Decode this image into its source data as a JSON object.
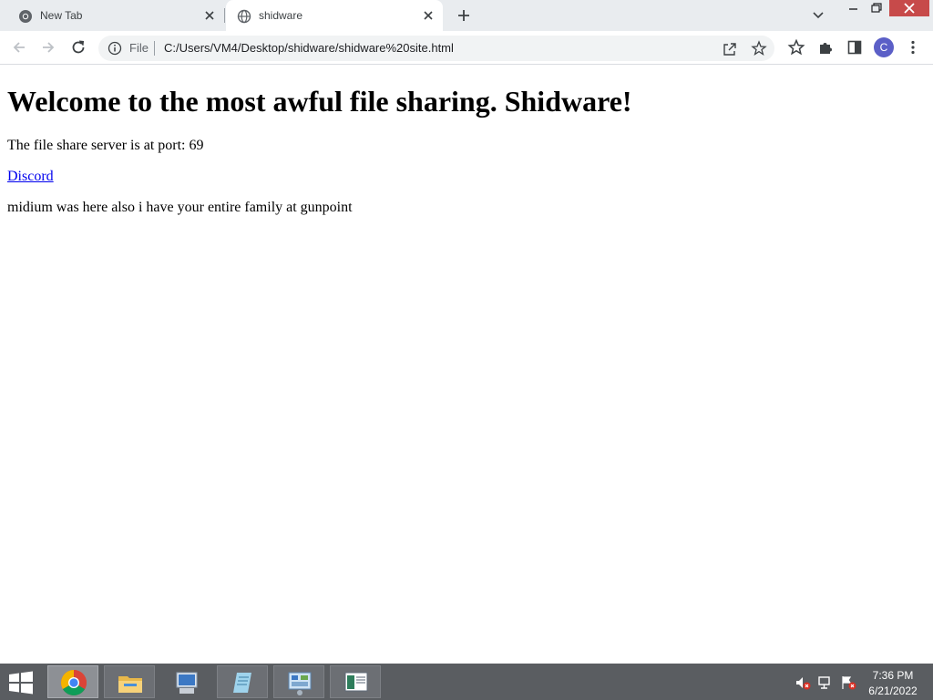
{
  "tabs": [
    {
      "title": "New Tab",
      "favicon": "chrome-icon"
    },
    {
      "title": "shidware",
      "favicon": "globe-icon"
    }
  ],
  "omnibox": {
    "scheme_label": "File",
    "url": "C:/Users/VM4/Desktop/shidware/shidware%20site.html"
  },
  "profile": {
    "initial": "C",
    "color": "#5b5fc7"
  },
  "page": {
    "heading": "Welcome to the most awful file sharing. Shidware!",
    "port_text": "The file share server is at port: 69",
    "link_text": "Discord",
    "message": "midium was here also i have your entire family at gunpoint"
  },
  "taskbar": {
    "apps": [
      "chrome-icon",
      "file-explorer-icon",
      "server-manager-icon",
      "notepad-icon",
      "control-panel-icon",
      "remote-desktop-icon"
    ],
    "time": "7:36 PM",
    "date": "6/21/2022"
  },
  "colors": {
    "link": "#0000ee",
    "close_button": "#c74a4a",
    "taskbar": "#5a5d61"
  }
}
